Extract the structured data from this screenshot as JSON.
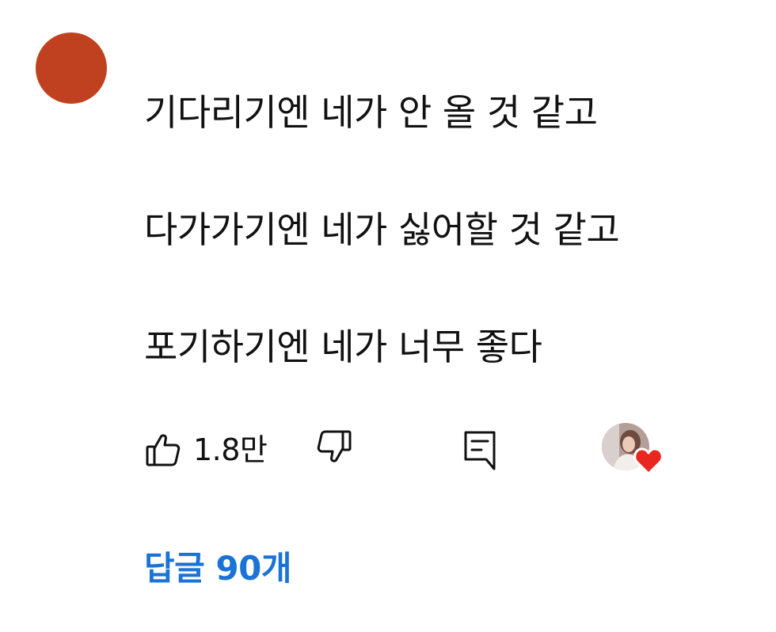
{
  "comment": {
    "author_avatar_color": "#c0411f",
    "lines": [
      "기다리기엔 네가 안 올 것 같고",
      "다가가기엔 네가 싫어할 것 같고",
      "포기하기엔 네가 너무 좋다"
    ]
  },
  "actions": {
    "like_icon": "thumbs-up-icon",
    "like_count": "1.8만",
    "dislike_icon": "thumbs-down-icon",
    "reply_icon": "comment-icon",
    "creator_heart_icon": "heart-icon",
    "heart_color": "#e8281e"
  },
  "replies": {
    "label": "답글 90개",
    "color": "#1a73d6"
  }
}
